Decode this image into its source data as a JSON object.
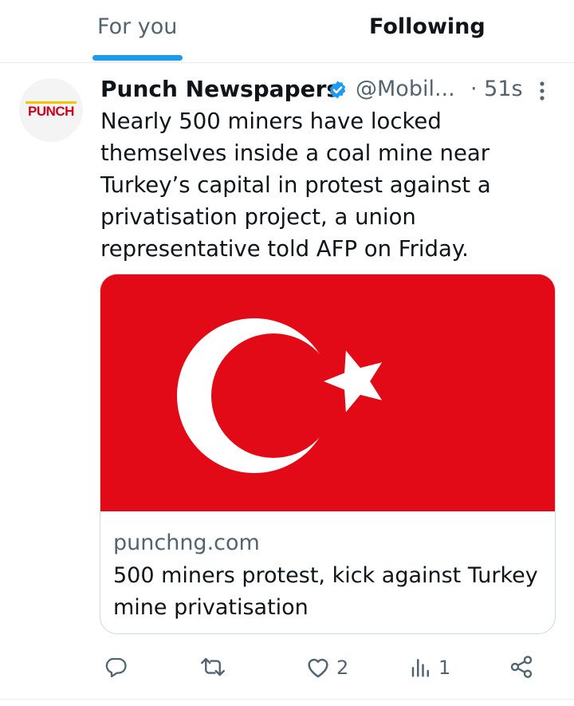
{
  "tabs": [
    {
      "label": "For you",
      "active": false
    },
    {
      "label": "Following",
      "active": true
    }
  ],
  "tweet": {
    "avatar_text": "PUNCH",
    "author_name": "Punch Newspapers",
    "verified": true,
    "handle": "@Mobil...",
    "timestamp": "· 51s",
    "text": "Nearly 500 miners have locked themselves inside a coal mine near Turkey’s capital in protest against a privatisation project, a union representative told AFP on Friday.",
    "card": {
      "domain": "punchng.com",
      "title": "500 miners protest, kick against Turkey mine privatisation"
    },
    "actions": {
      "reply_count": "",
      "repost_count": "",
      "like_count": "2",
      "view_count": "1"
    }
  },
  "colors": {
    "accent": "#1d9bf0",
    "flag_red": "#e30a17",
    "secondary_text": "#536471",
    "punch_red": "#d0021b"
  },
  "icons": [
    "verified-badge-icon",
    "more-options-icon",
    "reply-icon",
    "repost-icon",
    "like-icon",
    "views-icon",
    "share-icon"
  ]
}
